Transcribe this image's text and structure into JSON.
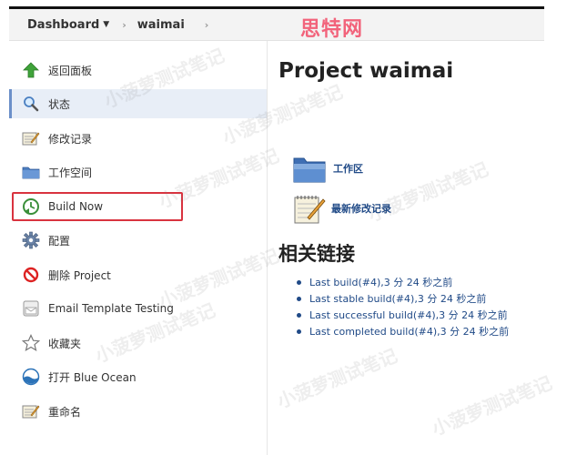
{
  "breadcrumb": {
    "dashboard": "Dashboard",
    "project": "waimai"
  },
  "brand_logo": "思特网",
  "sidebar": {
    "items": [
      {
        "label": "返回面板",
        "icon": "up-arrow-icon"
      },
      {
        "label": "状态",
        "icon": "magnifier-icon"
      },
      {
        "label": "修改记录",
        "icon": "notepad-icon"
      },
      {
        "label": "工作空间",
        "icon": "folder-icon"
      },
      {
        "label": "Build Now",
        "icon": "build-clock-icon"
      },
      {
        "label": "配置",
        "icon": "gear-icon"
      },
      {
        "label": "删除 Project",
        "icon": "no-entry-icon"
      },
      {
        "label": "Email Template Testing",
        "icon": "envelope-icon"
      },
      {
        "label": "收藏夹",
        "icon": "star-icon"
      },
      {
        "label": "打开 Blue Ocean",
        "icon": "blue-ocean-icon"
      },
      {
        "label": "重命名",
        "icon": "notepad-icon"
      }
    ]
  },
  "main": {
    "title": "Project waimai",
    "workspace_link": "工作区",
    "changes_link": "最新修改记录",
    "related_title": "相关链接",
    "builds": [
      "Last build(#4),3 分 24 秒之前",
      "Last stable build(#4),3 分 24 秒之前",
      "Last successful build(#4),3 分 24 秒之前",
      "Last completed build(#4),3 分 24 秒之前"
    ]
  },
  "watermark_text": "小菠萝测试笔记"
}
